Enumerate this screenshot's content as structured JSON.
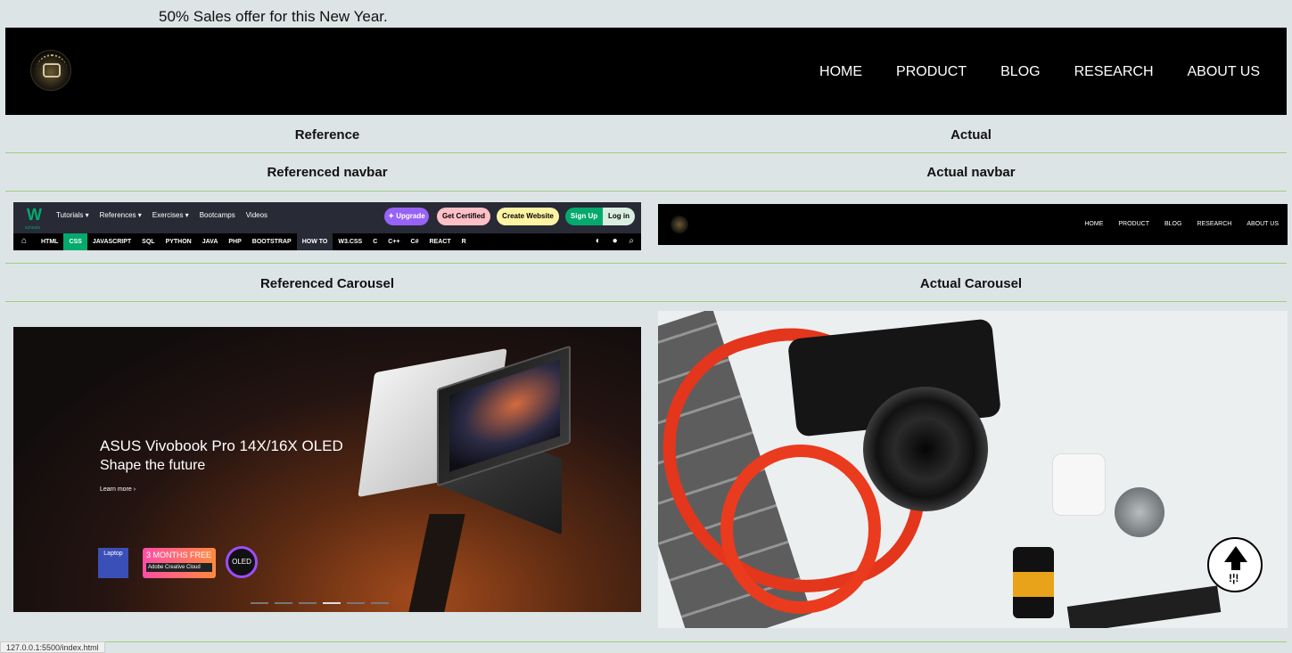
{
  "offer_bar": {
    "text": "50% Sales offer for this New Year."
  },
  "main_nav": {
    "items": [
      "HOME",
      "PRODUCT",
      "BLOG",
      "RESEARCH",
      "ABOUT US"
    ]
  },
  "sections": {
    "left_header": "Reference",
    "right_header": "Actual",
    "left_navbar_title": "Referenced navbar",
    "right_navbar_title": "Actual navbar",
    "left_carousel_title": "Referenced Carousel",
    "right_carousel_title": "Actual Carousel"
  },
  "w3_nav": {
    "logo_text": "W",
    "logo_sub": "schools",
    "menu": [
      "Tutorials ▾",
      "References ▾",
      "Exercises ▾",
      "Bootcamps",
      "Videos"
    ],
    "buttons": {
      "upgrade": "✦ Upgrade",
      "certified": "Get Certified",
      "create": "Create Website",
      "signup": "Sign Up",
      "login": "Log in"
    },
    "links": [
      "HTML",
      "CSS",
      "JAVASCRIPT",
      "SQL",
      "PYTHON",
      "JAVA",
      "PHP",
      "BOOTSTRAP",
      "HOW TO",
      "W3.CSS",
      "C",
      "C++",
      "C#",
      "REACT",
      "R"
    ],
    "active_link": "CSS",
    "colors": {
      "bg": "#282a35",
      "accent": "#04aa6d",
      "upgrade": "#9763f6",
      "certified": "#ffc0c7",
      "create": "#fff4a3"
    }
  },
  "mini_nav": {
    "items": [
      "HOME",
      "PRODUCT",
      "BLOG",
      "RESEARCH",
      "ABOUT US"
    ]
  },
  "asus_slide": {
    "title": "ASUS Vivobook Pro 14X/16X OLED",
    "subtitle": "Shape the future",
    "link": "Learn more ›",
    "badge_laptop": "Laptop",
    "badge_free_big": "3",
    "badge_free": "MONTHS FREE",
    "badge_free_sub": "Adobe Creative Cloud",
    "badge_oled": "OLED"
  },
  "status_bar": {
    "url": "127.0.0.1:5500/index.html"
  }
}
